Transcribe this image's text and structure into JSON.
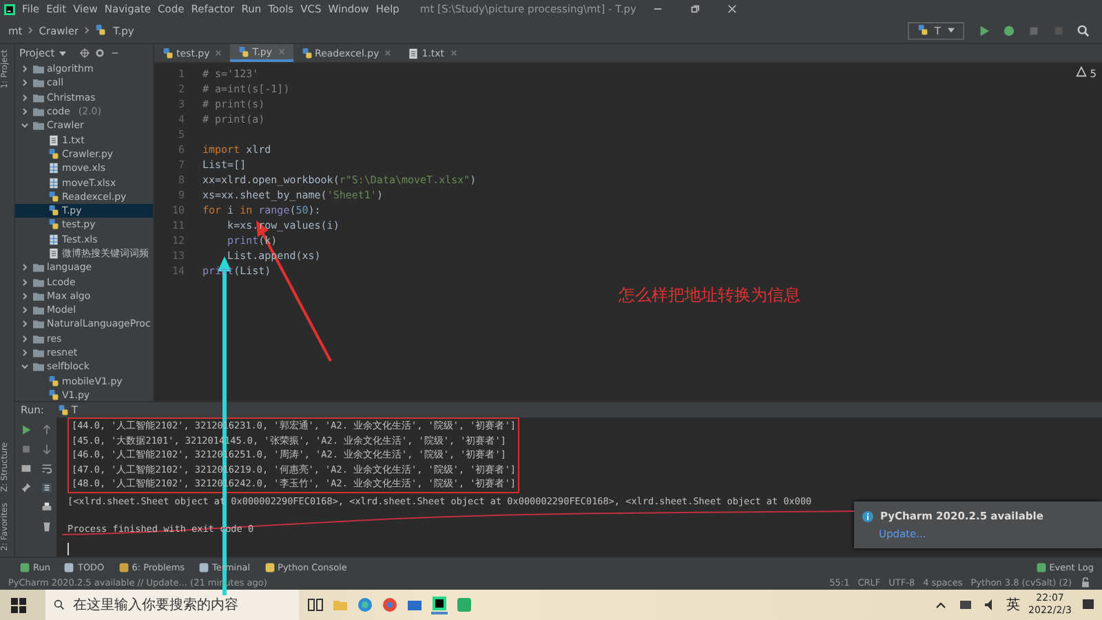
{
  "window": {
    "title": "mt [S:\\Study\\picture processing\\mt] - T.py"
  },
  "menu": [
    "File",
    "Edit",
    "View",
    "Navigate",
    "Code",
    "Refactor",
    "Run",
    "Tools",
    "VCS",
    "Window",
    "Help"
  ],
  "breadcrumb": [
    {
      "label": "mt",
      "kind": "folder"
    },
    {
      "label": "Crawler",
      "kind": "folder"
    },
    {
      "label": "T.py",
      "kind": "py"
    }
  ],
  "run_config": {
    "label": "T"
  },
  "side_tabs": {
    "top": [
      "1: Project"
    ],
    "bottom": [
      "Z: Structure",
      "2: Favorites"
    ]
  },
  "project": {
    "title": "Project",
    "items": [
      {
        "label": "algorithm",
        "kind": "folder",
        "expanded": false,
        "selected": false
      },
      {
        "label": "call",
        "kind": "folder",
        "expanded": false,
        "selected": false
      },
      {
        "label": "Christmas",
        "kind": "folder",
        "expanded": false,
        "selected": false
      },
      {
        "label": "code",
        "note": "(2.0)",
        "kind": "folder",
        "expanded": false,
        "selected": false
      },
      {
        "label": "Crawler",
        "kind": "folder",
        "expanded": true,
        "selected": false,
        "children": [
          {
            "label": "1.txt",
            "kind": "txt",
            "selected": false
          },
          {
            "label": "Crawler.py",
            "kind": "py",
            "selected": false
          },
          {
            "label": "move.xls",
            "kind": "xls",
            "selected": false
          },
          {
            "label": "moveT.xlsx",
            "kind": "xls",
            "selected": false
          },
          {
            "label": "Readexcel.py",
            "kind": "py",
            "selected": false
          },
          {
            "label": "T.py",
            "kind": "py",
            "selected": true
          },
          {
            "label": "test.py",
            "kind": "py",
            "selected": false
          },
          {
            "label": "Test.xls",
            "kind": "xls",
            "selected": false
          },
          {
            "label": "微博热搜关键词词频",
            "kind": "txt",
            "selected": false
          }
        ]
      },
      {
        "label": "language",
        "kind": "folder",
        "expanded": false,
        "selected": false
      },
      {
        "label": "Lcode",
        "kind": "folder",
        "expanded": false,
        "selected": false
      },
      {
        "label": "Max algo",
        "kind": "folder",
        "expanded": false,
        "selected": false
      },
      {
        "label": "Model",
        "kind": "folder",
        "expanded": false,
        "selected": false
      },
      {
        "label": "NaturalLanguageProc",
        "kind": "folder",
        "expanded": false,
        "selected": false
      },
      {
        "label": "res",
        "kind": "folder",
        "expanded": false,
        "selected": false
      },
      {
        "label": "resnet",
        "kind": "folder",
        "expanded": false,
        "selected": false
      },
      {
        "label": "selfblock",
        "kind": "folder",
        "expanded": true,
        "selected": false,
        "children": [
          {
            "label": "mobileV1.py",
            "kind": "py",
            "selected": false
          },
          {
            "label": "V1.py",
            "kind": "py",
            "selected": false
          }
        ]
      }
    ]
  },
  "editor": {
    "tabs": [
      {
        "label": "test.py",
        "kind": "py",
        "selected": false
      },
      {
        "label": "T.py",
        "kind": "py",
        "selected": true
      },
      {
        "label": "Readexcel.py",
        "kind": "py",
        "selected": false
      },
      {
        "label": "1.txt",
        "kind": "txt",
        "selected": false
      }
    ],
    "warning_count": "5",
    "lines": [
      {
        "n": "1",
        "tokens": [
          {
            "t": "# s='123'",
            "kind": "comment"
          }
        ]
      },
      {
        "n": "2",
        "tokens": [
          {
            "t": "# a=int(s[-1])",
            "kind": "comment"
          }
        ]
      },
      {
        "n": "3",
        "tokens": [
          {
            "t": "# print(s)",
            "kind": "comment"
          }
        ]
      },
      {
        "n": "4",
        "tokens": [
          {
            "t": "# print(a)",
            "kind": "comment"
          }
        ]
      },
      {
        "n": "5"
      },
      {
        "n": "6",
        "tokens": [
          {
            "t": "import",
            "kind": "keyword"
          },
          {
            "t": " xlrd",
            "kind": "plain"
          }
        ]
      },
      {
        "n": "7",
        "tokens": [
          {
            "t": "List=[]",
            "kind": "plain"
          }
        ]
      },
      {
        "n": "8",
        "tokens": [
          {
            "t": "xx=xlrd.open_workbook(",
            "kind": "plain"
          },
          {
            "t": "r\"S:\\Data\\moveT.xlsx\"",
            "kind": "string"
          },
          {
            "t": ")",
            "kind": "plain"
          }
        ]
      },
      {
        "n": "9",
        "tokens": [
          {
            "t": "xs=xx.sheet_by_name(",
            "kind": "plain"
          },
          {
            "t": "'Sheet1'",
            "kind": "string"
          },
          {
            "t": ")",
            "kind": "plain"
          }
        ]
      },
      {
        "n": "10",
        "tokens": [
          {
            "t": "for",
            "kind": "keyword"
          },
          {
            "t": " i ",
            "kind": "plain"
          },
          {
            "t": "in ",
            "kind": "keyword"
          },
          {
            "t": "range",
            "kind": "builtin"
          },
          {
            "t": "(",
            "kind": "plain"
          },
          {
            "t": "50",
            "kind": "number"
          },
          {
            "t": "):",
            "kind": "plain"
          }
        ]
      },
      {
        "n": "11",
        "tokens": [
          {
            "t": "    k=xs.row_values(i)",
            "kind": "plain"
          }
        ]
      },
      {
        "n": "12",
        "tokens": [
          {
            "t": "    print",
            "kind": "builtin"
          },
          {
            "t": "(k)",
            "kind": "plain"
          }
        ]
      },
      {
        "n": "13",
        "tokens": [
          {
            "t": "    List.append(xs)",
            "kind": "plain"
          }
        ]
      },
      {
        "n": "14",
        "tokens": [
          {
            "t": "print",
            "kind": "builtin"
          },
          {
            "t": "(List)",
            "kind": "plain"
          }
        ]
      }
    ]
  },
  "annotation": {
    "text": "怎么样把地址转换为信息"
  },
  "run_panel": {
    "title": "Run:",
    "tab": "T",
    "highlighted_output": [
      "[44.0, '人工智能2102', 3212016231.0, '郭宏通', 'A2. 业余文化生活', '院级', '初赛者']",
      "[45.0, '大数据2101', 3212014145.0, '张荣振', 'A2. 业余文化生活', '院级', '初赛者']",
      "[46.0, '人工智能2102', 3212016251.0, '周涛', 'A2. 业余文化生活', '院级', '初赛者']",
      "[47.0, '人工智能2102', 3212016219.0, '何惠亮', 'A2. 业余文化生活', '院级', '初赛者']",
      "[48.0, '人工智能2102', 3212016242.0, '李玉竹', 'A2. 业余文化生活', '院级', '初赛者']"
    ],
    "output": "[<xlrd.sheet.Sheet object at 0x000002290FEC0168>, <xlrd.sheet.Sheet object at 0x000002290FEC0168>, <xlrd.sheet.Sheet object at 0x000",
    "exit_message": "Process finished with exit code 0"
  },
  "notification": {
    "title": "PyCharm 2020.2.5 available",
    "link": "Update..."
  },
  "tool_tabs": [
    {
      "label": "Run",
      "kind": "run"
    },
    {
      "label": "TODO",
      "kind": "todo"
    },
    {
      "label": "6: Problems",
      "kind": "problems"
    },
    {
      "label": "Terminal",
      "kind": "terminal"
    },
    {
      "label": "Python Console",
      "kind": "console"
    }
  ],
  "event_log": "Event Log",
  "status_bar": {
    "message": "PyCharm 2020.2.5 available // Update... (21 minutes ago)",
    "items": [
      "55:1",
      "CRLF",
      "UTF-8",
      "4 spaces",
      "Python 3.8 (cvSalt) (2)"
    ]
  },
  "taskbar": {
    "search_placeholder": "在这里输入你要搜索的内容",
    "ime": "英",
    "time": "22:07",
    "date": "2022/2/3"
  }
}
